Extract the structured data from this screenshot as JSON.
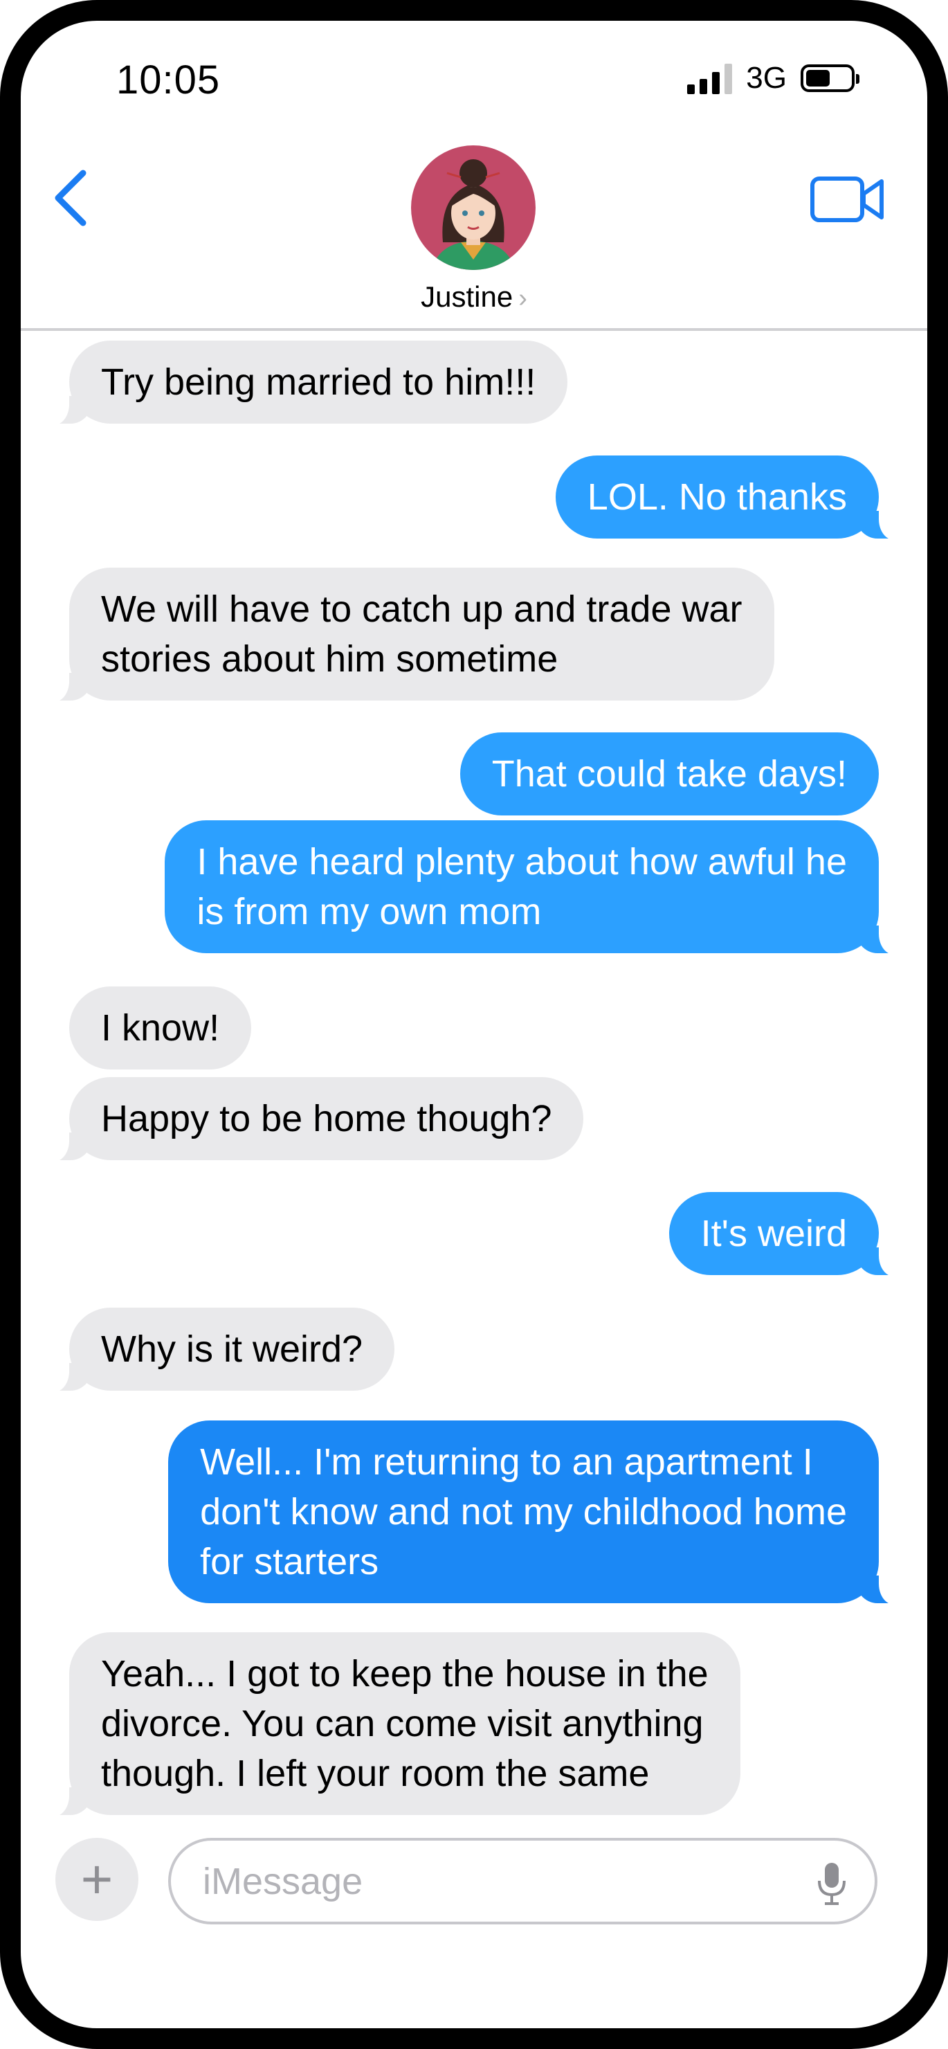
{
  "status_bar": {
    "time": "10:05",
    "network": "3G"
  },
  "header": {
    "contact_name": "Justine",
    "chevron": "›"
  },
  "icons": {
    "back": "chevron-left-icon",
    "video": "video-camera-icon",
    "plus": "plus-icon",
    "mic": "microphone-icon"
  },
  "colors": {
    "accent": "#1b7cf2",
    "outgoing": "#2ca0ff",
    "outgoing_alt": "#1b88f5",
    "incoming": "#e9e9eb"
  },
  "messages": [
    {
      "dir": "in",
      "text": "Try being married to him!!!"
    },
    {
      "dir": "out",
      "text": "LOL.  No thanks"
    },
    {
      "dir": "in",
      "text": "We will have to catch up and trade war\nstories about him sometime"
    },
    {
      "dir": "out",
      "text": "That could take days!"
    },
    {
      "dir": "out",
      "text": "I have heard plenty about how awful he\nis from my own mom"
    },
    {
      "dir": "in",
      "text": "I know!"
    },
    {
      "dir": "in",
      "text": "Happy to be home though?"
    },
    {
      "dir": "out",
      "text": "It's weird"
    },
    {
      "dir": "in",
      "text": "Why is it weird?"
    },
    {
      "dir": "out",
      "text": "Well... I'm returning to an apartment I\ndon't know and not my childhood home\nfor starters"
    },
    {
      "dir": "in",
      "text": "Yeah... I got to keep the house in the\ndivorce.  You can come visit anything\nthough.  I left your room the same"
    }
  ],
  "composer": {
    "placeholder": "iMessage",
    "plus_label": "+"
  }
}
